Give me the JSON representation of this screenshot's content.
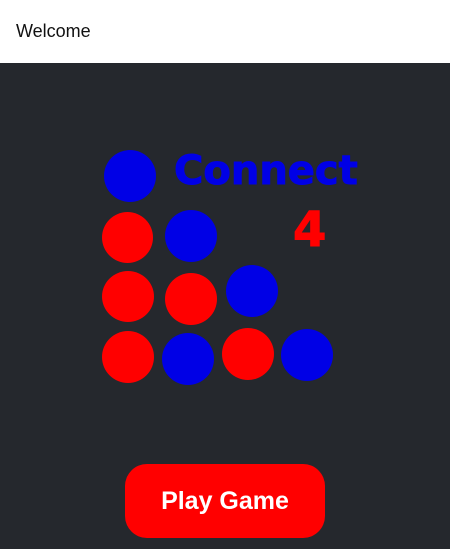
{
  "header": {
    "title": "Welcome"
  },
  "logo": {
    "word": "Connect",
    "number": "4",
    "colors": {
      "blue": "#0000e6",
      "red": "#ff0000"
    }
  },
  "play_button": {
    "label": "Play Game",
    "color": "#ff0000"
  }
}
